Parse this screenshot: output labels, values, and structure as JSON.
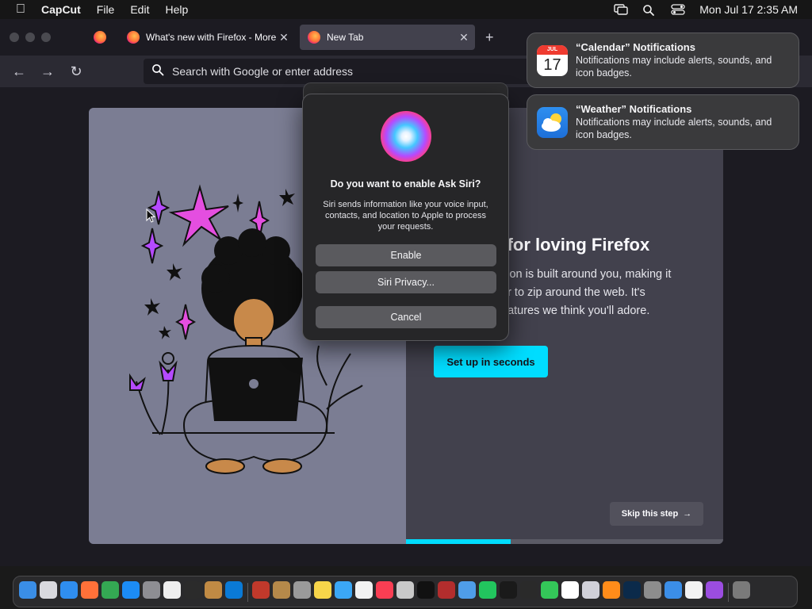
{
  "menubar": {
    "app_name": "CapCut",
    "menus": [
      "File",
      "Edit",
      "Help"
    ],
    "clock": "Mon Jul 17  2:35 AM"
  },
  "tabs": [
    {
      "title": "What's new with Firefox - More",
      "active": false
    },
    {
      "title": "New Tab",
      "active": true
    }
  ],
  "urlbar": {
    "placeholder": "Search with Google or enter address"
  },
  "onboarding": {
    "title": "u for loving Firefox",
    "body_lines": [
      "sion is built around you, making it",
      "er to zip around the web. It's",
      "eatures we think you'll adore."
    ],
    "cta_label": "Set up in seconds",
    "skip_label": "Skip this step",
    "progress_fraction": 0.33
  },
  "siri_dialog": {
    "title": "Do you want to enable Ask Siri?",
    "body": "Siri sends information like your voice input, contacts, and location to Apple to process your requests.",
    "enable_label": "Enable",
    "privacy_label": "Siri Privacy...",
    "cancel_label": "Cancel"
  },
  "notifications": [
    {
      "app": "Calendar",
      "title": "“Calendar” Notifications",
      "text": "Notifications may include alerts, sounds, and icon badges.",
      "icon_month": "JUL",
      "icon_day": "17"
    },
    {
      "app": "Weather",
      "title": "“Weather” Notifications",
      "text": "Notifications may include alerts, sounds, and icon badges."
    }
  ],
  "dock": {
    "apps": [
      {
        "name": "finder-icon",
        "color": "#3a8ee6"
      },
      {
        "name": "launchpad-icon",
        "color": "#d9d9de"
      },
      {
        "name": "safari-icon",
        "color": "#2f8ef0"
      },
      {
        "name": "firefox-icon",
        "color": "#ff7139"
      },
      {
        "name": "chrome-icon",
        "color": "#34a853"
      },
      {
        "name": "app-store-icon",
        "color": "#1c8cf5"
      },
      {
        "name": "system-settings-icon",
        "color": "#8e8e93"
      },
      {
        "name": "script-editor-icon",
        "color": "#eeeeee"
      },
      {
        "name": "terminal-icon",
        "color": "#2b2b2b"
      },
      {
        "name": "brush-app-icon",
        "color": "#c08a44"
      },
      {
        "name": "vscode-icon",
        "color": "#0a7ad6"
      },
      {
        "name": "red-app-icon",
        "color": "#c0392b"
      },
      {
        "name": "folder-app-icon",
        "color": "#b5894a"
      },
      {
        "name": "photo-app-icon",
        "color": "#9a9a9a"
      },
      {
        "name": "notes-icon",
        "color": "#f7d54a"
      },
      {
        "name": "cloud-app-icon",
        "color": "#3ba7f5"
      },
      {
        "name": "reminders-icon",
        "color": "#f2f2f2"
      },
      {
        "name": "news-icon",
        "color": "#fa3e53"
      },
      {
        "name": "font-book-icon",
        "color": "#c9c9c9"
      },
      {
        "name": "capcut-icon",
        "color": "#111111"
      },
      {
        "name": "dictionary-icon",
        "color": "#b32d2d"
      },
      {
        "name": "preview-icon",
        "color": "#4f9de8"
      },
      {
        "name": "find-my-icon",
        "color": "#22c55e"
      },
      {
        "name": "apple-tv-icon",
        "color": "#1a1a1a"
      },
      {
        "name": "stocks-icon",
        "color": "#2a2a2a"
      },
      {
        "name": "messages-icon",
        "color": "#34c759"
      },
      {
        "name": "calendar-icon",
        "color": "#ffffff"
      },
      {
        "name": "screenshot-icon",
        "color": "#d0d0d8"
      },
      {
        "name": "books-icon",
        "color": "#ff8c1a"
      },
      {
        "name": "lightroom-icon",
        "color": "#0b2a4a"
      },
      {
        "name": "calculator-icon",
        "color": "#8d8d8d"
      },
      {
        "name": "keynote-icon",
        "color": "#3b8ee8"
      },
      {
        "name": "clock-icon",
        "color": "#f2f2f2"
      },
      {
        "name": "podcasts-icon",
        "color": "#9b4de0"
      },
      {
        "name": "trash-icon",
        "color": "#7a7a7a"
      }
    ]
  }
}
